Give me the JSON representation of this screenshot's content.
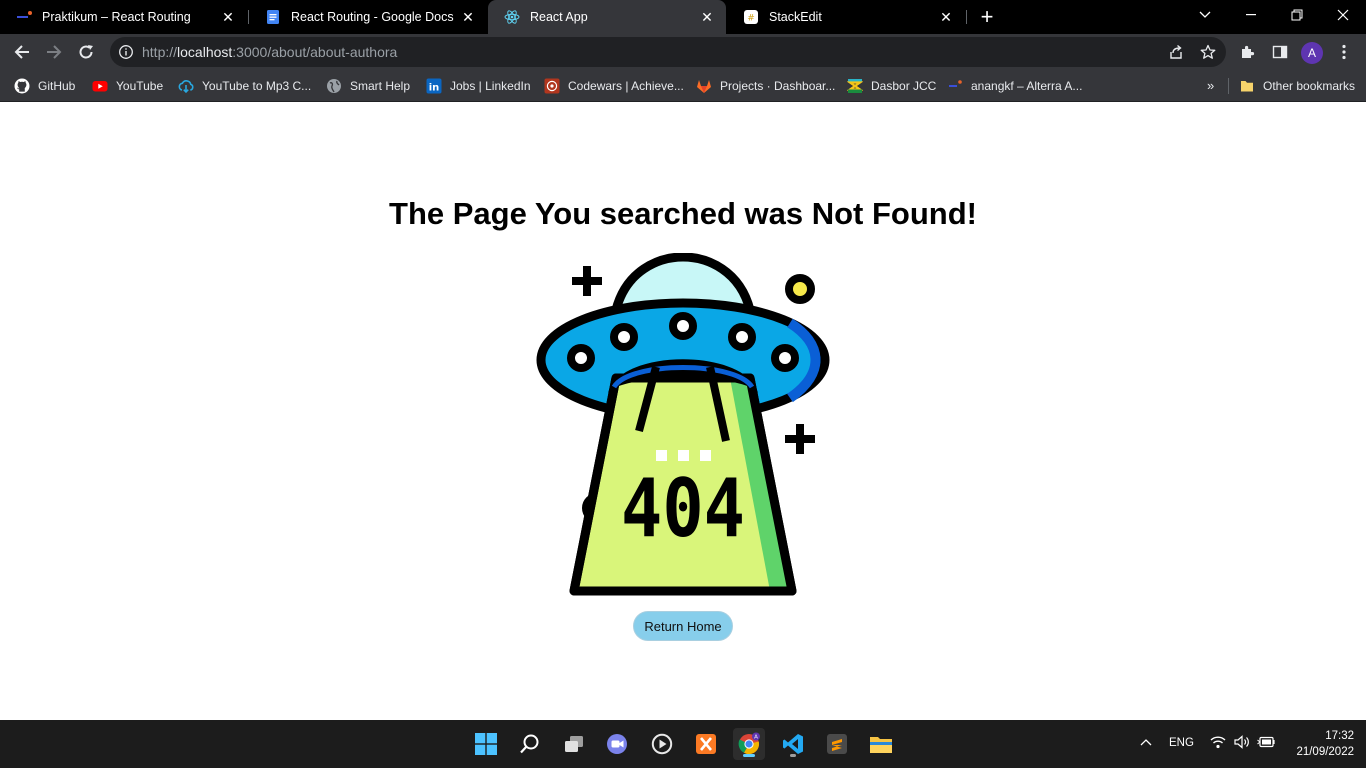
{
  "browser": {
    "tabs": [
      {
        "title": "Praktikum – React Routing",
        "active": false
      },
      {
        "title": "React Routing - Google Docs",
        "active": false
      },
      {
        "title": "React App",
        "active": true
      },
      {
        "title": "StackEdit",
        "active": false
      }
    ],
    "url": {
      "prefix": "http://",
      "host": "localhost",
      "path": ":3000/about/about-authora"
    },
    "profile_initial": "A"
  },
  "bookmarks": {
    "items": [
      {
        "label": "GitHub",
        "icon": "github-icon"
      },
      {
        "label": "YouTube",
        "icon": "youtube-icon"
      },
      {
        "label": "YouTube to Mp3 C...",
        "icon": "download-cloud-icon"
      },
      {
        "label": "Smart Help",
        "icon": "globe-icon"
      },
      {
        "label": "Jobs | LinkedIn",
        "icon": "linkedin-icon"
      },
      {
        "label": "Codewars | Achieve...",
        "icon": "codewars-icon"
      },
      {
        "label": "Projects · Dashboar...",
        "icon": "gitlab-icon"
      },
      {
        "label": "Dasbor JCC",
        "icon": "jcc-icon"
      },
      {
        "label": "anangkf – Alterra A...",
        "icon": "alterra-icon"
      }
    ],
    "more": "»",
    "other": "Other bookmarks"
  },
  "page": {
    "heading": "The Page You searched was Not Found!",
    "illustration_text": "404",
    "return_button": "Return Home"
  },
  "taskbar": {
    "language": "ENG",
    "time": "17:32",
    "date": "21/09/2022"
  },
  "colors": {
    "ufo_blue": "#0aa7e6",
    "ufo_dome": "#c8f7f7",
    "beam": "#d9f57a",
    "beam_edge": "#5fd36a",
    "light": "#f6e94a",
    "button": "#87ceeb"
  }
}
